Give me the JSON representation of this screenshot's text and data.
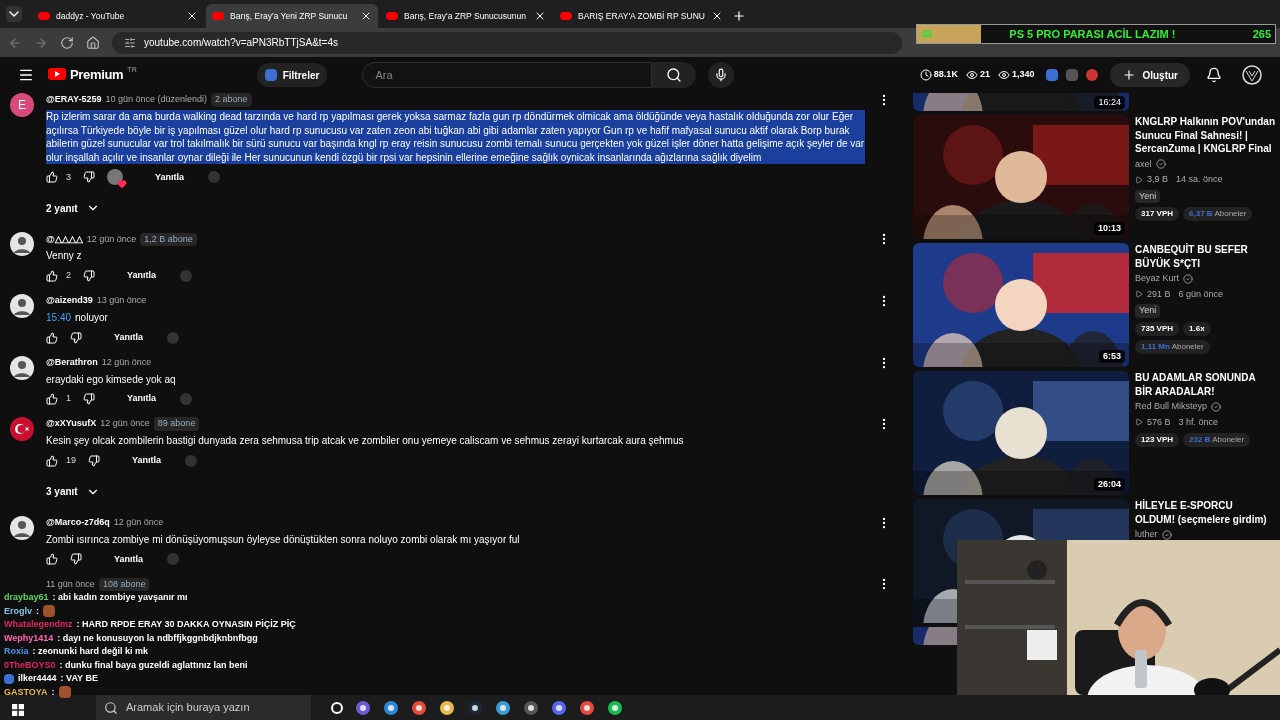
{
  "browser": {
    "tabs": [
      {
        "title": "daddyz - YouTube",
        "selected": false
      },
      {
        "title": "Barış, Eray'a Yeni ZRP Sunucu",
        "selected": true
      },
      {
        "title": "Barış, Eray'a ZRP Sunucusunun",
        "selected": false
      },
      {
        "title": "BARIŞ ERAY'A ZOMBİ RP SUNU",
        "selected": false
      }
    ],
    "url": "youtube.com/watch?v=aPN3RbTTjSA&t=4s"
  },
  "donation_overlay": {
    "current": "48",
    "goal_text": "PS 5 PRO PARASI ACİL LAZIM !",
    "target": "265",
    "level": 0.18
  },
  "header": {
    "logo": "Premium",
    "region": "TR",
    "filter_button": "Filtreler",
    "search": {
      "placeholder": "Ara"
    },
    "stats": [
      {
        "kind": "clock",
        "text": "88.1K"
      },
      {
        "kind": "eye",
        "text": "21"
      },
      {
        "kind": "views",
        "text": "1,340"
      }
    ],
    "create_button": "Oluştur"
  },
  "comments": [
    {
      "avatar": {
        "kind": "letter",
        "letter": "E",
        "color": "#d84a7a"
      },
      "author": "@ERAY-5259",
      "time": "10 gün önce (düzenlendi)",
      "badge": "2 abone",
      "text": "Rp izlerim sarar da ama burda walking dead tarzında ve hard rp yapılması gerek yoksa sarmaz fazla gun rp döndürmek olmicak ama öldüğünde veya hastalık olduğunda zor olur Eğer açılırsa Türkiyede böyle bir iş yapılması güzel olur hard rp sunucusu var zaten zeon abi tuğkan abi gibi adamlar zaten yapıyor Gun rp ve hafif mafyasal sunucu aktif olarak Borp burak abilerin güzel sunucular var trol takılmalık bir sürü sunucu var başında kngl rp eray reisin sunucusu zombi temalı sunucu gerçekten yok güzel işler döner hatta gelişime açık şeyler de var olur inşallah açılır ve insanlar oynar dileği ile Her sunucunun kendi özgü bir rpsi var hepsinin ellerine emeğine sağlık oynicak insanlarında ağızlarına sağlık diyelim",
      "text_highlighted": true,
      "likes": "3",
      "hearted": true,
      "reply": "Yanıtla",
      "replies": "2 yanıt"
    },
    {
      "author": "@△△△△",
      "time": "12 gün önce",
      "badge": "1,2 B abone",
      "text": "Venny z",
      "text_highlighted": false,
      "likes": "2",
      "hearted": false,
      "reply": "Yanıtla"
    },
    {
      "author": "@aizend39",
      "time": "13 gün önce",
      "timestamp": "15:40",
      "text": "noluyor",
      "text_highlighted": false,
      "hearted": false,
      "reply": "Yanıtla"
    },
    {
      "author": "@Berathron",
      "time": "12 gün önce",
      "text": "eraydaki ego kimsede yok aq",
      "text_highlighted": false,
      "likes": "1",
      "hearted": false,
      "reply": "Yanıtla"
    },
    {
      "avatar": {
        "kind": "flag"
      },
      "author": "@xXYusufX",
      "time": "12 gün önce",
      "badge": "89 abone",
      "text": "Kesin şey olcak zombilerin bastigi dunyada zera sehmusa trip atcak ve zombiler onu yemeye caliscam ve sehmus zerayi kurtarcak aura şehmus",
      "text_highlighted": false,
      "likes": "19",
      "hearted": false,
      "reply": "Yanıtla",
      "replies": "3 yanıt"
    },
    {
      "author": "@Marco-z7d6q",
      "time": "12 gün önce",
      "text": "Zombi ısırınca zombiye mi dönüşüyomuşsun öyleyse dönüştükten sonra noluyo zombi olarak mı yaşıyor ful",
      "text_highlighted": false,
      "hearted": false,
      "reply": "Yanıtla"
    },
    {
      "avatar": {
        "kind": "none"
      },
      "time": "11 gün önce",
      "badge": "108 abone"
    }
  ],
  "chat_overlay": [
    {
      "user": "draybay61",
      "color": "#5fd35f",
      "text": ": abi kadın zombiye yavşanır mı"
    },
    {
      "user": "Eroglv",
      "color": "#7ec8e3",
      "text": ":",
      "emote": true
    },
    {
      "user": "Whatalegendmz",
      "color": "#e0245e",
      "text": ": HARD RPDE ERAY 30 DAKKA OYNASIN PİÇİZ PİÇ"
    },
    {
      "user": "Wephy1414",
      "color": "#ff69b4",
      "text": ": dayı ne konusuyon la ndbffjkggnbdjknbnfbgg"
    },
    {
      "user": "Roxia",
      "color": "#4f8fe6",
      "text": ": zeonunki hard değil ki mk"
    },
    {
      "user": "0TheBOYS0",
      "color": "#e0245e",
      "text": ": dunku final baya guzeldi aglattınız lan beni"
    },
    {
      "user": "ilker4444",
      "color": "#ffffff",
      "text": ": VAY BE",
      "badges": true
    },
    {
      "user": "GASTOYA",
      "color": "#e8b84a",
      "text": ":",
      "emote": true
    }
  ],
  "sidebar": [
    {
      "kind": "partial",
      "duration": "16:24"
    },
    {
      "kind": "video",
      "title": "KNGLRP Halkının POV'undan Sunucu Final Sahnesi! | SercanZuma | KNGLRP Final",
      "channel": "axel",
      "verified": true,
      "views": "3,9 B",
      "age": "14 sa. önce",
      "badge": "Yeni",
      "chips": [
        "317 VPH"
      ],
      "subs_value": "6,37 B",
      "subs_label": "Aboneler",
      "duration": "10:13"
    },
    {
      "kind": "video",
      "title": "CANBEQUİT BU SEFER BÜYÜK S*ÇTI",
      "channel": "Beyaz Kurt",
      "verified": true,
      "views": "291 B",
      "age": "6 gün önce",
      "badge": "Yeni",
      "chips": [
        "735 VPH",
        "1.6x"
      ],
      "subs_value": "1,11 Mn",
      "subs_label": "Aboneler",
      "duration": "6:53"
    },
    {
      "kind": "video",
      "title": "BU ADAMLAR SONUNDA BİR ARADALAR!",
      "channel": "Red Bull Miksteyp",
      "verified": true,
      "views": "576 B",
      "age": "3 hf. önce",
      "chips": [
        "123 VPH"
      ],
      "subs_value": "232 B",
      "subs_label": "Aboneler",
      "duration": "26:04"
    },
    {
      "kind": "video",
      "title": "HİLEYLE E-SPORCU OLDUM! (seçmelere girdim)",
      "channel": "luther",
      "verified": true
    },
    {
      "kind": "partial"
    }
  ],
  "taskbar": {
    "search": {
      "placeholder": "Aramak için buraya yazın"
    }
  }
}
